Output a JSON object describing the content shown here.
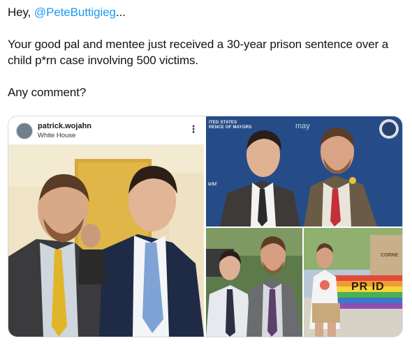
{
  "tweet": {
    "greeting_prefix": "Hey, ",
    "mention": "@PeteButtigieg",
    "greeting_suffix": "...",
    "body": "Your good pal and mentee just received a 30-year prison sentence over a child p*rn case involving 500 victims.",
    "question": "Any comment?"
  },
  "media": {
    "instagram": {
      "username": "patrick.wojahn",
      "location": "White House",
      "more_icon": "more-vertical-icon",
      "more_glyph": "⋮"
    },
    "top_right": {
      "banner_line1": "ITED STATES",
      "banner_line2": "RENCE OF MAYORS",
      "brand_partial": "may",
      "logo_partial": "usr"
    },
    "bottom_right": {
      "sign_partial": "CORNE",
      "banner_partial": "PR  ID"
    }
  }
}
